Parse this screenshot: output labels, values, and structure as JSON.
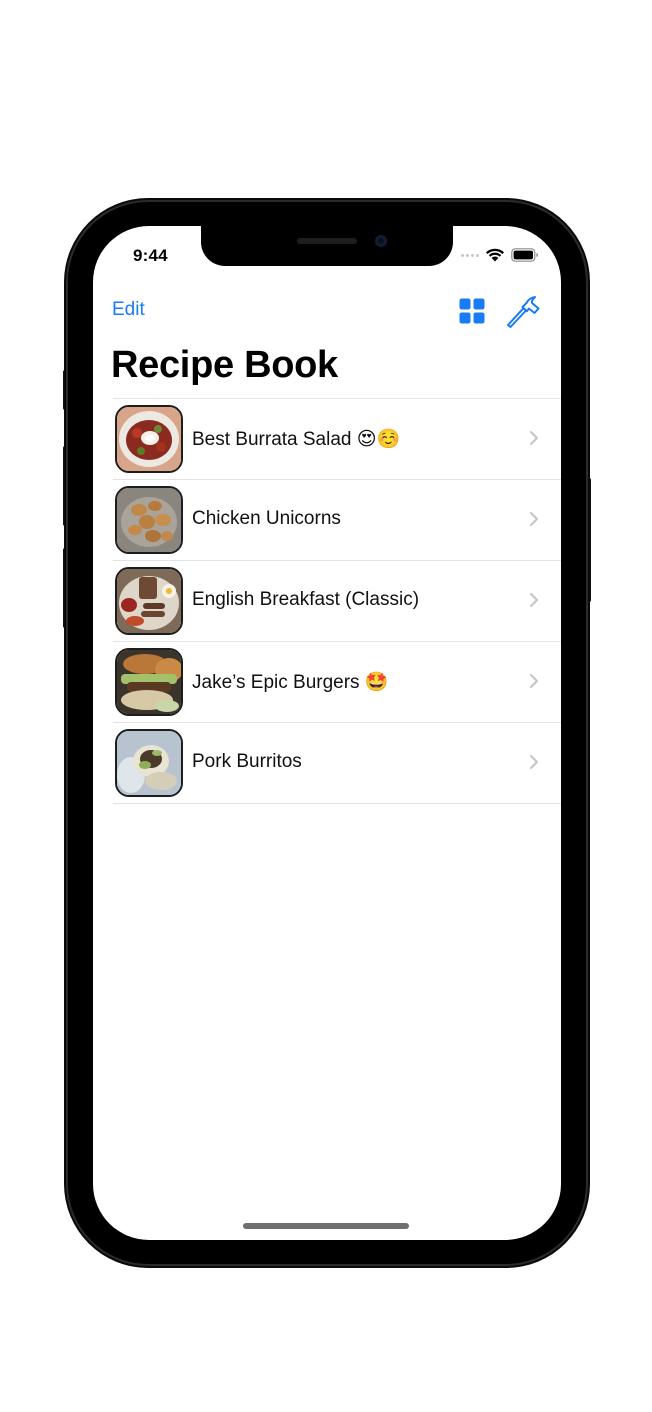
{
  "status_bar": {
    "time": "9:44"
  },
  "nav": {
    "edit_label": "Edit",
    "grid_icon": "grid-layout-icon",
    "hammer_icon": "hammer-icon",
    "accent_color": "#1a7cf5"
  },
  "title": "Recipe Book",
  "recipes": [
    {
      "label": "Best Burrata Salad 😍☺️",
      "thumbnail": "burrata-salad-photo"
    },
    {
      "label": "Chicken Unicorns",
      "thumbnail": "chicken-nuggets-photo"
    },
    {
      "label": "English Breakfast (Classic)",
      "thumbnail": "english-breakfast-photo"
    },
    {
      "label": "Jake’s Epic Burgers 🤩",
      "thumbnail": "burger-photo"
    },
    {
      "label": "Pork Burritos",
      "thumbnail": "burrito-photo"
    }
  ]
}
